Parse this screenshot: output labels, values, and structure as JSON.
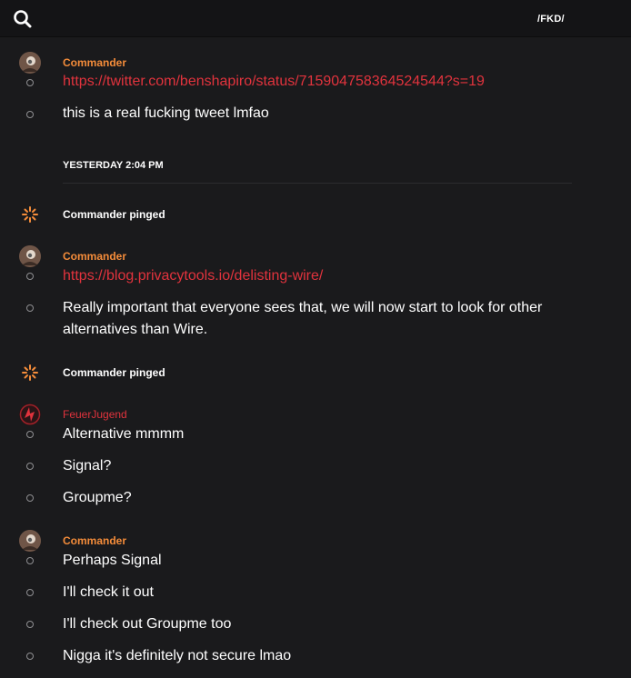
{
  "header": {
    "title": "/FKD/",
    "search_icon": "search-icon"
  },
  "colors": {
    "background": "#1a1a1c",
    "topbar": "#141416",
    "commander_name": "#f48c3a",
    "feuer_name": "#e1333d",
    "link": "#e1333d"
  },
  "messages": [
    {
      "author": "Commander",
      "link": "https://twitter.com/benshapiro/status/715904758364524544?s=19",
      "text": "this is a real fucking tweet lmfao"
    }
  ],
  "day_separator": "YESTERDAY 2:04 PM",
  "ping_1": {
    "text": "Commander pinged",
    "icon": "ping-icon"
  },
  "group_2": {
    "author": "Commander",
    "link": "https://blog.privacytools.io/delisting-wire/",
    "text": "Really important that everyone sees that, we will now start to look for other alternatives than Wire."
  },
  "ping_2": {
    "text": "Commander pinged",
    "icon": "ping-icon"
  },
  "group_3": {
    "author": "FeuerJugend",
    "lines": [
      "Alternative mmmm",
      "Signal?",
      "Groupme?"
    ]
  },
  "group_4": {
    "author": "Commander",
    "lines": [
      "Perhaps Signal",
      "I'll check it out",
      "I'll check out Groupme too",
      "Nigga it's definitely not secure lmao"
    ]
  }
}
